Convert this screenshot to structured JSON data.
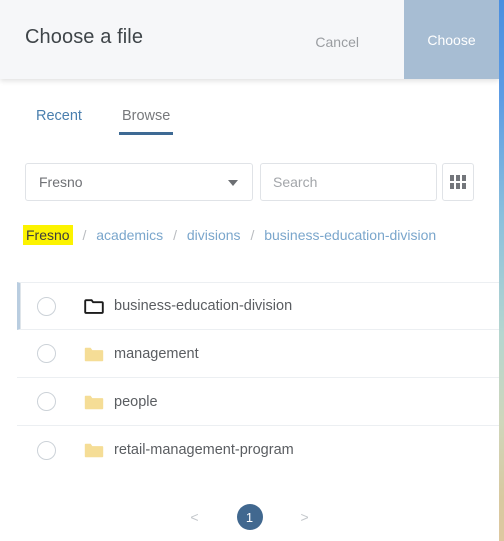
{
  "header": {
    "title": "Choose a file",
    "cancel_label": "Cancel",
    "choose_label": "Choose",
    "choose_button_color": "#a7bdd3"
  },
  "tabs": [
    {
      "label": "Recent",
      "active": false
    },
    {
      "label": "Browse",
      "active": true
    }
  ],
  "filters": {
    "site_select_value": "Fresno",
    "search_placeholder": "Search",
    "search_value": "",
    "grid_view_icon": "grid-icon"
  },
  "breadcrumb": {
    "separator": "/",
    "highlight_color": "#fcf300",
    "items": [
      {
        "label": "Fresno",
        "highlighted": true
      },
      {
        "label": "academics",
        "highlighted": false
      },
      {
        "label": "divisions",
        "highlighted": false
      },
      {
        "label": "business-education-division",
        "highlighted": false
      }
    ]
  },
  "file_list": {
    "rows": [
      {
        "label": "business-education-division",
        "icon": "folder-open-outline-icon",
        "selected": true
      },
      {
        "label": "management",
        "icon": "folder-icon",
        "selected": false
      },
      {
        "label": "people",
        "icon": "folder-icon",
        "selected": false
      },
      {
        "label": "retail-management-program",
        "icon": "folder-icon",
        "selected": false
      }
    ]
  },
  "pagination": {
    "prev_label": "<",
    "next_label": ">",
    "current_page": "1",
    "active_color": "#41688f"
  }
}
